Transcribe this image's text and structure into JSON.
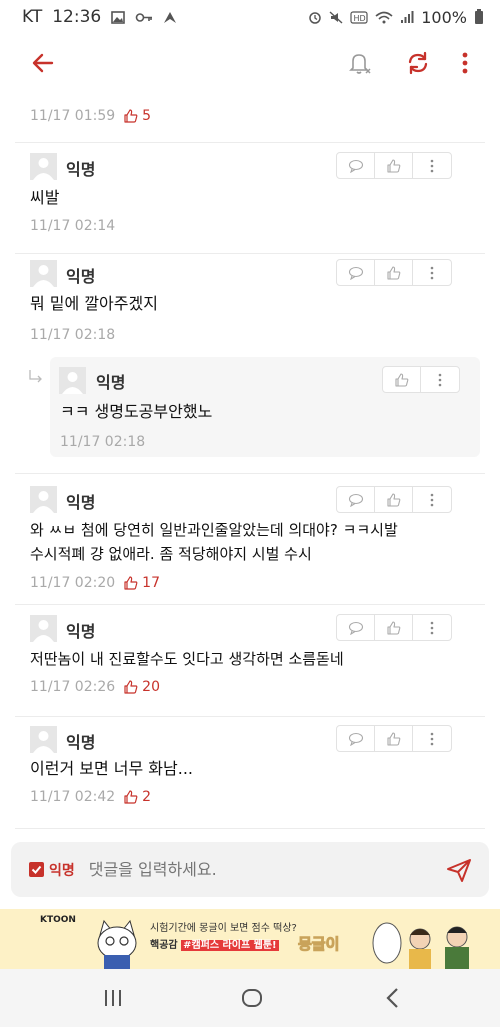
{
  "status": {
    "carrier": "KT",
    "time": "12:36",
    "battery": "100%",
    "left_icons": [
      "image-icon",
      "key-icon",
      "navigation-icon"
    ],
    "right_icons": [
      "alarm-icon",
      "mute-icon",
      "hd-icon",
      "wifi-icon",
      "signal-icon"
    ]
  },
  "appbar": {
    "back_icon": "back-arrow-icon",
    "bell_icon": "notifications-off-icon",
    "refresh_icon": "refresh-icon",
    "more_icon": "more-vertical-icon"
  },
  "colors": {
    "accent": "#c7322b",
    "meta_gray": "#a9a9a9",
    "reply_bg": "#f6f6f6",
    "input_bg": "#f2f2f2",
    "banner_bg": "#fdf1c6"
  },
  "top_meta": {
    "time": "11/17 01:59",
    "likes": "5"
  },
  "comments": [
    {
      "author": "익명",
      "body": "씨발",
      "time": "11/17 02:14",
      "likes": ""
    },
    {
      "author": "익명",
      "body": "뭐 밑에 깔아주겠지",
      "time": "11/17 02:18",
      "likes": "",
      "reply": {
        "author": "익명",
        "body": "ㅋㅋ 생명도공부안했노",
        "time": "11/17 02:18"
      }
    },
    {
      "author": "익명",
      "body_line1": "와 ㅆㅂ 첨에 당연히 일반과인줄알았는데 의대야? ㅋㅋ시발",
      "body_line2": "수시적폐 걍 없애라. 좀 적당해야지 시벌 수시",
      "time": "11/17 02:20",
      "likes": "17"
    },
    {
      "author": "익명",
      "body": "저딴놈이 내 진료할수도 잇다고 생각하면 소름돋네",
      "time": "11/17 02:26",
      "likes": "20"
    },
    {
      "author": "익명",
      "body": "이런거 보면 너무 화남...",
      "time": "11/17 02:42",
      "likes": "2"
    }
  ],
  "input": {
    "anon_label": "익명",
    "placeholder": "댓글을 입력하세요."
  },
  "banner": {
    "brand": "KTOON",
    "line1": "시험기간에 몽글이 보면 점수 떡상?",
    "line2_prefix": "핵공감 ",
    "line2_highlight": "#캠퍼스 라이프 웹툰!",
    "logo": "몽글이"
  }
}
